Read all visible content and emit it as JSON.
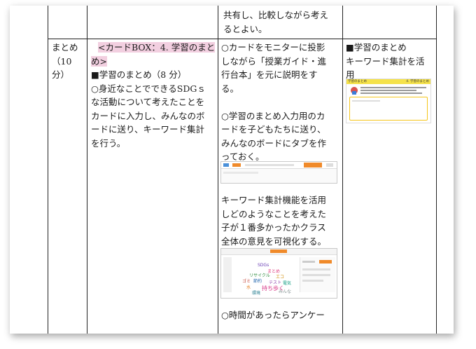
{
  "top_row": {
    "col3_lines": [
      "共有し、比較しながら考え",
      "るとよい。"
    ]
  },
  "col1": {
    "lines": [
      "まとめ",
      "（10",
      "分）"
    ]
  },
  "col2": {
    "card_box_line1": "<カードBOX：4. 学習のまと",
    "card_box_line2": "め>",
    "heading": "■学習のまとめ（8 分）",
    "body_lines": [
      "○身近なことでできるSDGｓ",
      "な活動について考えたことを",
      "カードに入力し、みんなのボ",
      "ードに送り、キーワード集計",
      "を行う。"
    ]
  },
  "col3": {
    "para1": [
      "○カードをモニターに投影",
      "しながら「授業ガイド・進",
      "行台本」を元に説明をす",
      "る。"
    ],
    "para2": [
      "○学習のまとめ入力用のカ",
      "ードを子どもたちに送り、",
      "みんなのボードにタブを作",
      "っておく。"
    ],
    "para3": [
      "キーワード集計機能を活用",
      "しどのようなことを考えた",
      "子が１番多かったかクラス",
      "全体の意見を可視化する。"
    ],
    "para4": [
      "○時間があったらアンケー"
    ]
  },
  "col4": {
    "lines": [
      "■学習のまとめ",
      "キーワード集計を活",
      "用"
    ],
    "card_title": "学習のまとめ",
    "card_tag": "4. 学習のまとめ"
  },
  "wordcloud": {
    "words": [
      "SDGs",
      "まとめ",
      "リサイクル",
      "エコ",
      "ゴミ",
      "節約",
      "テスト",
      "電気",
      "水",
      "持ち歩く",
      "環境",
      "みんな"
    ]
  },
  "colors": {
    "highlight": "#f2cfe0",
    "accent_orange": "#f08a2a",
    "card_yellow": "#f5e24a"
  }
}
